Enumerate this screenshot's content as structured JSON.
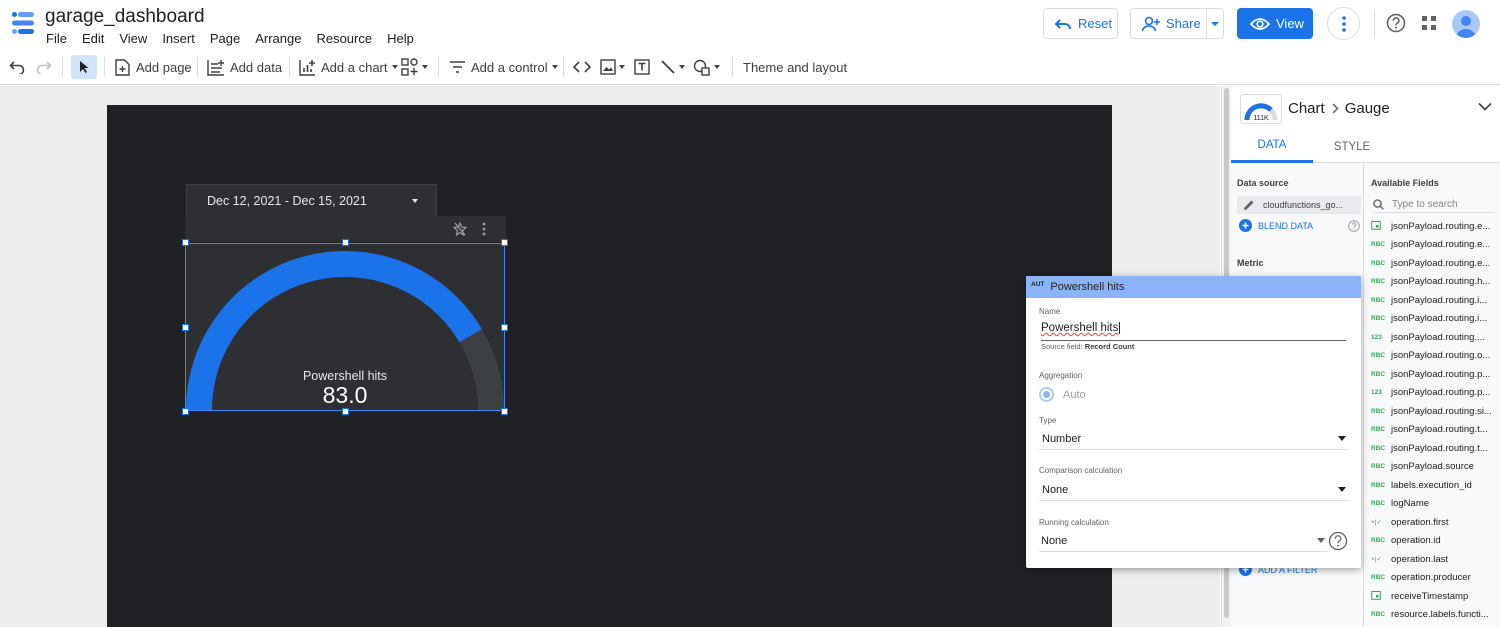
{
  "header": {
    "title": "garage_dashboard",
    "menu": [
      "File",
      "Edit",
      "View",
      "Insert",
      "Page",
      "Arrange",
      "Resource",
      "Help"
    ],
    "reset_label": "Reset",
    "share_label": "Share",
    "view_label": "View"
  },
  "toolbar": {
    "add_page": "Add page",
    "add_data": "Add data",
    "add_chart": "Add a chart",
    "add_control": "Add a control",
    "theme_layout": "Theme and layout"
  },
  "canvas": {
    "date_range": "Dec 12, 2021 - Dec 15, 2021",
    "gauge": {
      "label": "Powershell hits",
      "value_text": "83.0",
      "value": 83.0,
      "fill_fraction": 0.83,
      "fill_color": "#1a73e8",
      "track_color": "#3c4043"
    }
  },
  "panel": {
    "thumb_text": "111K",
    "crumb_parent": "Chart",
    "crumb_child": "Gauge",
    "tabs": {
      "data": "DATA",
      "style": "STYLE"
    },
    "data_source_label": "Data source",
    "data_source_name": "cloudfunctions_go...",
    "blend_label": "BLEND DATA",
    "metric_label": "Metric",
    "add_filter_label": "ADD A FILTER",
    "fields_label": "Available Fields",
    "search_placeholder": "Type to search",
    "fields": [
      {
        "type": "date",
        "name": "jsonPayload.routing.e..."
      },
      {
        "type": "RBC",
        "name": "jsonPayload.routing.e..."
      },
      {
        "type": "RBC",
        "name": "jsonPayload.routing.e..."
      },
      {
        "type": "RBC",
        "name": "jsonPayload.routing.h..."
      },
      {
        "type": "RBC",
        "name": "jsonPayload.routing.i..."
      },
      {
        "type": "RBC",
        "name": "jsonPayload.routing.i..."
      },
      {
        "type": "123",
        "name": "jsonPayload.routing...."
      },
      {
        "type": "RBC",
        "name": "jsonPayload.routing.o..."
      },
      {
        "type": "RBC",
        "name": "jsonPayload.routing.p..."
      },
      {
        "type": "123",
        "name": "jsonPayload.routing.p..."
      },
      {
        "type": "RBC",
        "name": "jsonPayload.routing.si..."
      },
      {
        "type": "RBC",
        "name": "jsonPayload.routing.t..."
      },
      {
        "type": "RBC",
        "name": "jsonPayload.routing.t..."
      },
      {
        "type": "RBC",
        "name": "jsonPayload.source"
      },
      {
        "type": "RBC",
        "name": "labels.execution_id"
      },
      {
        "type": "RBC",
        "name": "logName"
      },
      {
        "type": "bool",
        "name": "operation.first"
      },
      {
        "type": "RBC",
        "name": "operation.id"
      },
      {
        "type": "bool",
        "name": "operation.last"
      },
      {
        "type": "RBC",
        "name": "operation.producer"
      },
      {
        "type": "date",
        "name": "receiveTimestamp"
      },
      {
        "type": "RBC",
        "name": "resource.labels.functi..."
      }
    ]
  },
  "popup": {
    "tag": "AUT",
    "title": "Powershell hits",
    "name_label": "Name",
    "name_value": "Powershell hits",
    "source_field_prefix": "Source field:",
    "source_field": "Record Count",
    "aggregation_label": "Aggregation",
    "aggregation_value": "Auto",
    "type_label": "Type",
    "type_value": "Number",
    "comparison_label": "Comparison calculation",
    "comparison_value": "None",
    "running_label": "Running calculation",
    "running_value": "None"
  }
}
